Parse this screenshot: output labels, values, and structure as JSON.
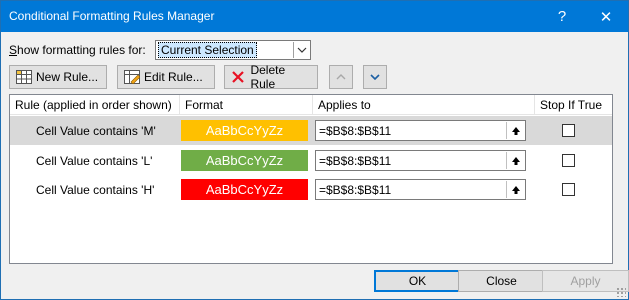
{
  "window": {
    "title": "Conditional Formatting Rules Manager",
    "help_glyph": "?",
    "close_glyph": "✕"
  },
  "filter": {
    "label_prefix": "S",
    "label_rest": "how formatting rules for:",
    "selected": "Current Selection"
  },
  "toolbar": {
    "new_rule": "New Rule...",
    "edit_rule": "Edit Rule...",
    "delete_rule": "Delete Rule"
  },
  "grid": {
    "headers": [
      "Rule (applied in order shown)",
      "Format",
      "Applies to",
      "Stop If True"
    ],
    "rows": [
      {
        "rule": "Cell Value contains 'M'",
        "sample": "AaBbCcYyZz",
        "sample_bg": "#ffc000",
        "sample_color": "#ffffff",
        "applies_to": "=$B$8:$B$11",
        "stop": false,
        "selected": true
      },
      {
        "rule": "Cell Value contains 'L'",
        "sample": "AaBbCcYyZz",
        "sample_bg": "#70ad47",
        "sample_color": "#ffffff",
        "applies_to": "=$B$8:$B$11",
        "stop": false,
        "selected": false
      },
      {
        "rule": "Cell Value contains 'H'",
        "sample": "AaBbCcYyZz",
        "sample_bg": "#ff0000",
        "sample_color": "#ffffff",
        "applies_to": "=$B$8:$B$11",
        "stop": false,
        "selected": false
      }
    ]
  },
  "buttons": {
    "ok": "OK",
    "close": "Close",
    "apply": "Apply"
  },
  "colors": {
    "title_bar": "#0078d7",
    "delete_icon": "#e81123",
    "arrow_icon": "#1c5fa3"
  }
}
